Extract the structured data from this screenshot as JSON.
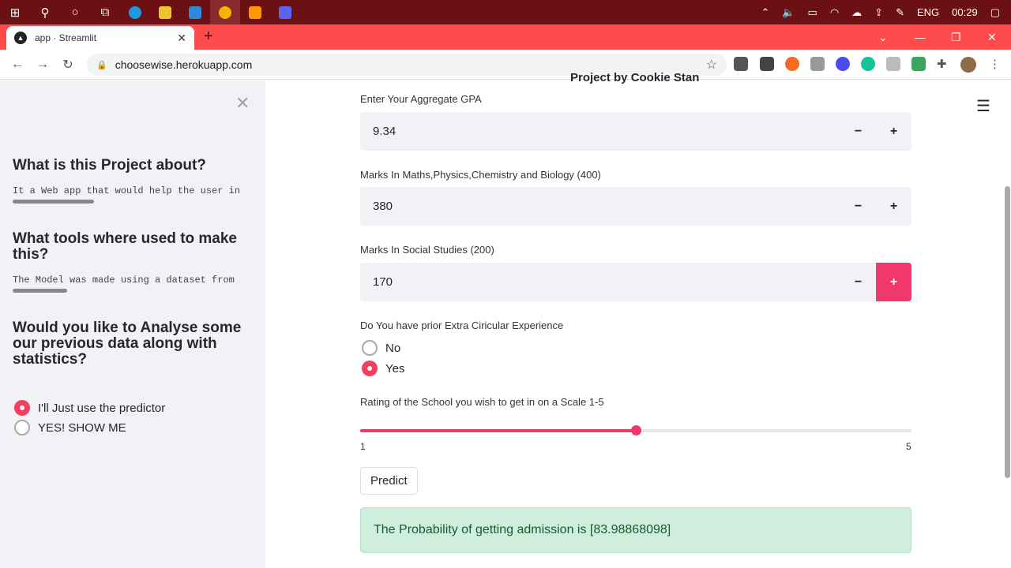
{
  "taskbar": {
    "lang": "ENG",
    "time": "00:29"
  },
  "browser": {
    "tab_title": "app · Streamlit",
    "url": "choosewise.herokuapp.com"
  },
  "sidebar": {
    "heading1": "What is this Project about?",
    "text1": "It a Web app that would help the user in",
    "heading2": "What tools where used to make this?",
    "text2": "The Model was made using a dataset from",
    "heading3": "Would you like to Analyse some our previous data along with statistics?",
    "options": [
      {
        "label": "I'll Just use the predictor",
        "selected": true
      },
      {
        "label": "YES! SHOW ME",
        "selected": false
      }
    ]
  },
  "main": {
    "cut_title": "Project by Cookie Stan",
    "gpa": {
      "label": "Enter Your Aggregate GPA",
      "value": "9.34"
    },
    "mpcb": {
      "label": "Marks In Maths,Physics,Chemistry and Biology (400)",
      "value": "380"
    },
    "social": {
      "label": "Marks In Social Studies (200)",
      "value": "170"
    },
    "extra": {
      "label": "Do You have prior Extra Ciricular Experience",
      "options": [
        {
          "label": "No",
          "selected": false
        },
        {
          "label": "Yes",
          "selected": true
        }
      ]
    },
    "rating": {
      "label": "Rating of the School you wish to get in on a Scale 1-5",
      "min": "1",
      "max": "5",
      "value": 3
    },
    "predict_label": "Predict",
    "result_text": "The Probability of getting admission is [83.98868098]",
    "minus": "−",
    "plus": "+"
  },
  "colors": {
    "accent": "#f0396a",
    "tabstrip": "#ff4b4b",
    "success_bg": "#cfeedd"
  }
}
